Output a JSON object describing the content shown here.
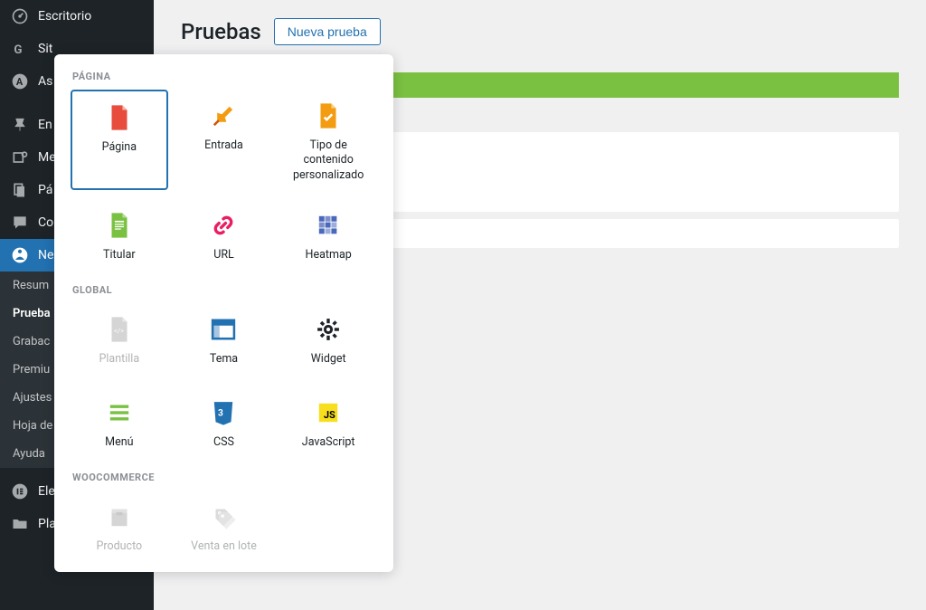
{
  "sidebar": {
    "items": [
      {
        "label": "Escritorio"
      },
      {
        "label": "Sit"
      },
      {
        "label": "As"
      },
      {
        "label": "En"
      },
      {
        "label": "Me"
      },
      {
        "label": "Pá"
      },
      {
        "label": "Co"
      },
      {
        "label": "Ne"
      }
    ],
    "subitems": [
      {
        "label": "Resum"
      },
      {
        "label": "Prueba"
      },
      {
        "label": "Grabac"
      },
      {
        "label": "Premiu"
      },
      {
        "label": "Ajustes"
      },
      {
        "label": "Hoja de"
      },
      {
        "label": "Ayuda"
      }
    ],
    "bottom": [
      {
        "label": "Ele"
      },
      {
        "label": "Plantillas"
      }
    ]
  },
  "header": {
    "title": "Pruebas",
    "new_button": "Nueva prueba"
  },
  "popup": {
    "sections": {
      "pagina": {
        "label": "PÁGINA",
        "tiles": [
          {
            "label": "Página"
          },
          {
            "label": "Entrada"
          },
          {
            "label": "Tipo de contenido personalizado"
          },
          {
            "label": "Titular"
          },
          {
            "label": "URL"
          },
          {
            "label": "Heatmap"
          }
        ]
      },
      "global": {
        "label": "GLOBAL",
        "tiles": [
          {
            "label": "Plantilla"
          },
          {
            "label": "Tema"
          },
          {
            "label": "Widget"
          },
          {
            "label": "Menú"
          },
          {
            "label": "CSS"
          },
          {
            "label": "JavaScript"
          }
        ]
      },
      "woocommerce": {
        "label": "WOOCOMMERCE",
        "tiles": [
          {
            "label": "Producto"
          },
          {
            "label": "Venta en lote"
          }
        ]
      }
    }
  }
}
